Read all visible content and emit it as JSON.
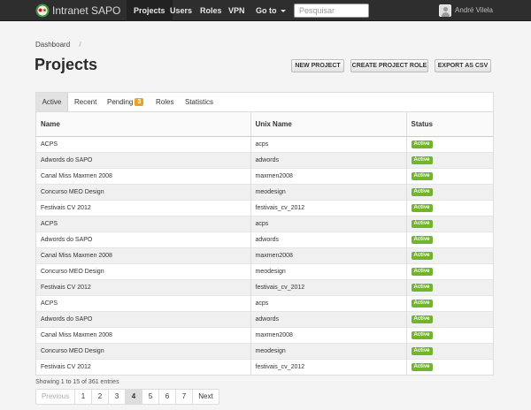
{
  "navbar": {
    "brand": "Intranet SAPO",
    "items": [
      "Projects",
      "Users",
      "Roles",
      "VPN"
    ],
    "goto_label": "Go to",
    "search_placeholder": "Pesquisar",
    "user_name": "André Vilela"
  },
  "breadcrumb": {
    "items": [
      "Dashboard"
    ],
    "separator": "/"
  },
  "page": {
    "title": "Projects",
    "buttons": [
      "NEW PROJECT",
      "CREATE PROJECT ROLE",
      "EXPORT AS CSV"
    ]
  },
  "tabs": [
    {
      "label": "Active"
    },
    {
      "label": "Recent"
    },
    {
      "label": "Pending",
      "badge": "3"
    },
    {
      "label": "Roles"
    },
    {
      "label": "Statistics"
    }
  ],
  "table": {
    "headers": [
      "Name",
      "Unix Name",
      "Status"
    ],
    "rows": [
      [
        "ACPS",
        "acps",
        "Active"
      ],
      [
        "Adwords do SAPO",
        "adwords",
        "Active"
      ],
      [
        "Canal Miss Maxmen 2008",
        "maxmen2008",
        "Active"
      ],
      [
        "Concurso MEO Design",
        "meodesign",
        "Active"
      ],
      [
        "Festivais CV 2012",
        "festivais_cv_2012",
        "Active"
      ],
      [
        "ACPS",
        "acps",
        "Active"
      ],
      [
        "Adwords do SAPO",
        "adwords",
        "Active"
      ],
      [
        "Canal Miss Maxmen 2008",
        "maxmen2008",
        "Active"
      ],
      [
        "Concurso MEO Design",
        "meodesign",
        "Active"
      ],
      [
        "Festivais CV 2012",
        "festivais_cv_2012",
        "Active"
      ],
      [
        "ACPS",
        "acps",
        "Active"
      ],
      [
        "Adwords do SAPO",
        "adwords",
        "Active"
      ],
      [
        "Canal Miss Maxmen 2008",
        "maxmen2008",
        "Active"
      ],
      [
        "Concurso MEO Design",
        "meodesign",
        "Active"
      ],
      [
        "Festivais CV 2012",
        "festivais_cv_2012",
        "Active"
      ]
    ]
  },
  "entries_text": "Showing 1 to 15 of 361 entries",
  "pagination": {
    "previous": "Previous",
    "pages": [
      "1",
      "2",
      "3",
      "4",
      "5",
      "6",
      "7"
    ],
    "current": "4",
    "next": "Next"
  },
  "colors": {
    "navbar_bg": "#2e2e2e",
    "status_active": "#72b42b",
    "badge": "#f0a020"
  }
}
